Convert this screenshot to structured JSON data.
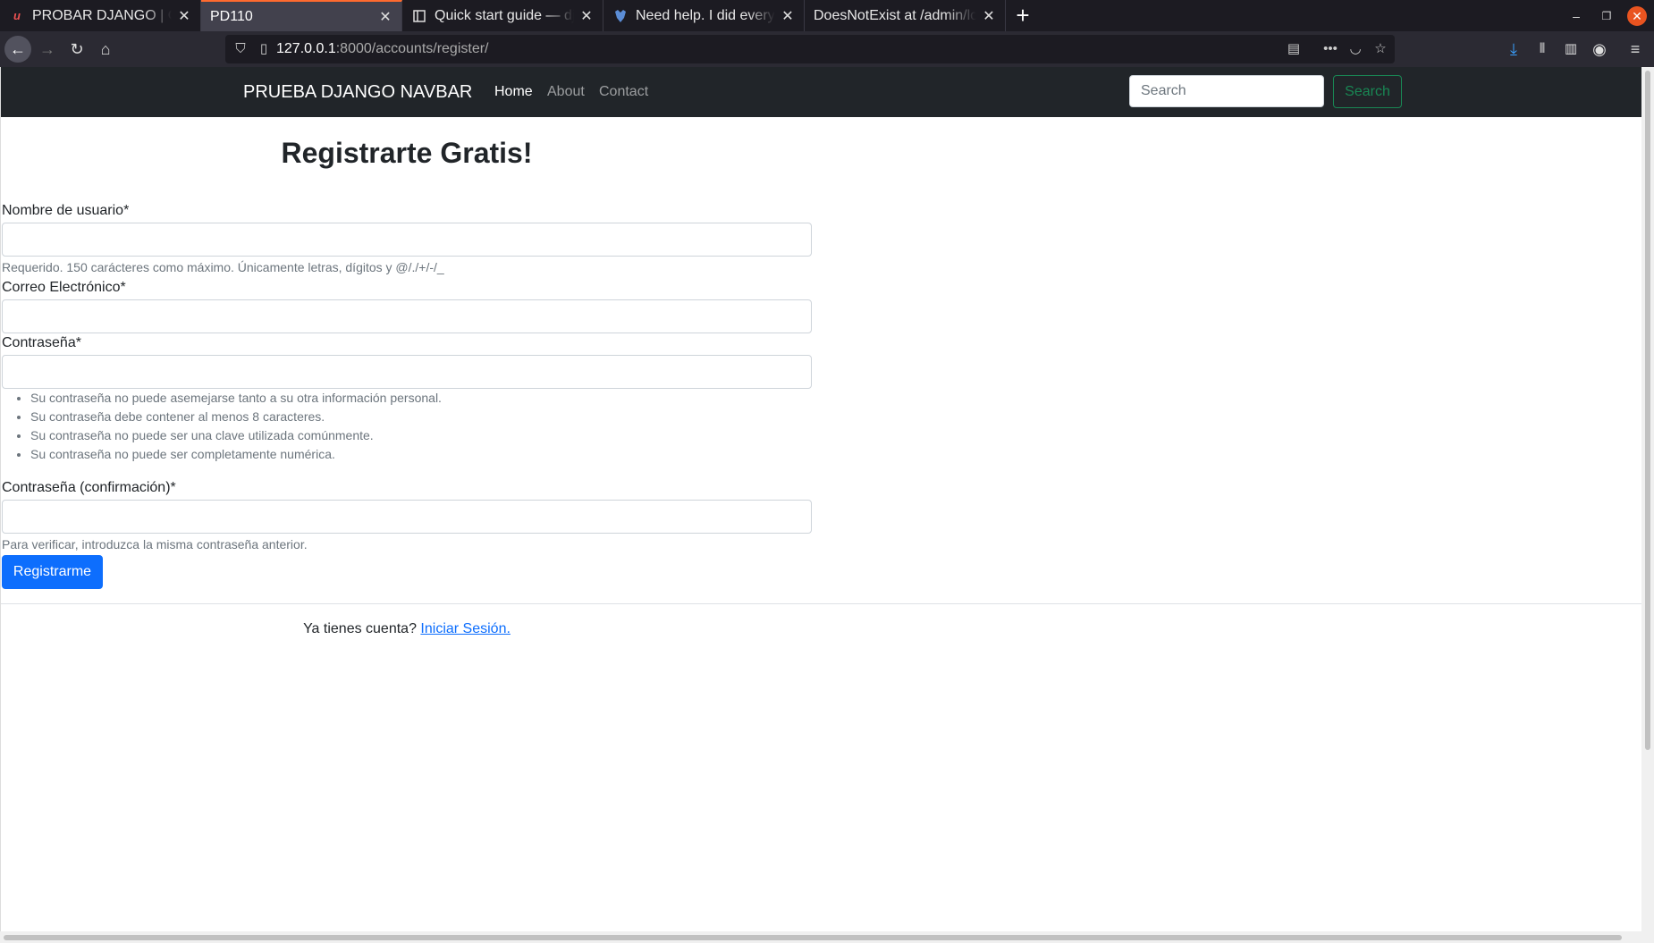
{
  "browser": {
    "tabs": [
      {
        "title": "PROBAR DJANGO | Crear",
        "icon": "udemy-icon",
        "active": false
      },
      {
        "title": "PD110",
        "icon": "",
        "active": true
      },
      {
        "title": "Quick start guide — django",
        "icon": "docs-icon",
        "active": false
      },
      {
        "title": "Need help. I did everything",
        "icon": "forum-icon",
        "active": false
      },
      {
        "title": "DoesNotExist at /admin/login",
        "icon": "",
        "active": false
      }
    ],
    "new_tab": "+",
    "url_host": "127.0.0.1",
    "url_rest": ":8000/accounts/register/"
  },
  "navbar": {
    "brand": "PRUEBA DJANGO NAVBAR",
    "links": [
      "Home",
      "About",
      "Contact"
    ],
    "search_placeholder": "Search",
    "search_button": "Search"
  },
  "form": {
    "title": "Registrarte Gratis!",
    "username_label": "Nombre de usuario*",
    "username_help": "Requerido. 150 carácteres como máximo. Únicamente letras, dígitos y @/./+/-/_",
    "email_label": "Correo Electrónico*",
    "password_label": "Contraseña*",
    "password_rules": [
      "Su contraseña no puede asemejarse tanto a su otra información personal.",
      "Su contraseña debe contener al menos 8 caracteres.",
      "Su contraseña no puede ser una clave utilizada comúnmente.",
      "Su contraseña no puede ser completamente numérica."
    ],
    "password2_label": "Contraseña (confirmación)*",
    "password2_help": "Para verificar, introduzca la misma contraseña anterior.",
    "submit": "Registrarme"
  },
  "footer": {
    "text": "Ya tienes cuenta?",
    "link": "Iniciar Sesión."
  },
  "colors": {
    "navbar_bg": "#212529",
    "primary": "#0d6efd",
    "success": "#198754"
  }
}
